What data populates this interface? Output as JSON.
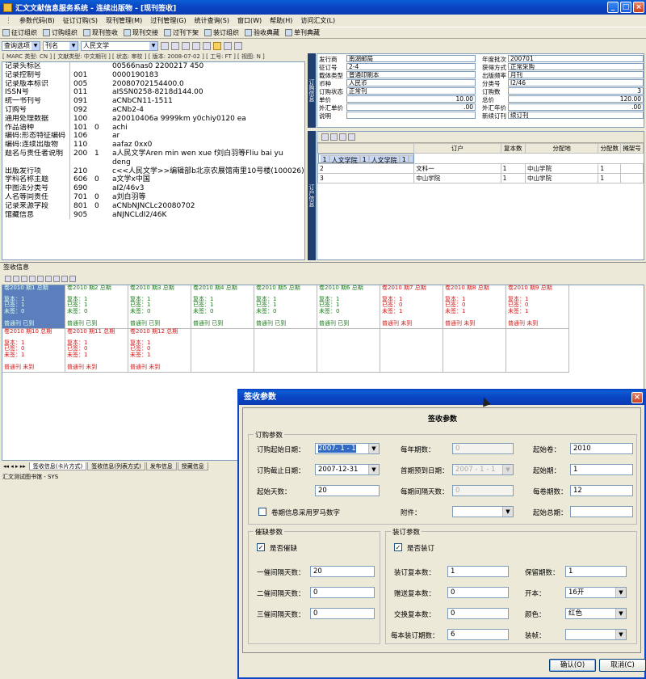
{
  "window": {
    "title": "汇文文献信息服务系统 - 连续出版物 - [现刊签收]"
  },
  "menu": [
    "参数代码(B)",
    "征订订购(S)",
    "现刊管理(M)",
    "过刊管理(G)",
    "统计查询(S)",
    "窗口(W)",
    "帮助(H)",
    "访问汇文(L)"
  ],
  "toolbar": [
    "征订组织",
    "订购组织",
    "现刊签收",
    "现刊交接",
    "过刊下架",
    "装订组织",
    "验收典藏",
    "单刊典藏"
  ],
  "query": {
    "label": "查询选项",
    "type": "刊名",
    "value": "人民文学"
  },
  "marc_header": "[ MARC 类型: CN ] [ 文献类型: 中文期刊 ] [ 状态: 审校 ] [ 版本: 2008-07-02 ] [ 工号: FT ] [ 视图: N ]",
  "marc": [
    {
      "label": "记录头标区",
      "tag": "",
      "ind": "",
      "value": "00566nas0 2200217 450"
    },
    {
      "label": "记录控制号",
      "tag": "001",
      "ind": "",
      "value": "0000190183"
    },
    {
      "label": "记录版本标识",
      "tag": "005",
      "ind": "",
      "value": "20080702154400.0"
    },
    {
      "label": "ISSN号",
      "tag": "011",
      "ind": "",
      "value": "aISSN0258-8218d144.00"
    },
    {
      "label": "统一书刊号",
      "tag": "091",
      "ind": "",
      "value": "aCNbCN11-1511"
    },
    {
      "label": "订购号",
      "tag": "092",
      "ind": "",
      "value": "aCNb2-4"
    },
    {
      "label": "通用处理数据",
      "tag": "100",
      "ind": "",
      "value": "a20010406a 9999km y0chiy0120 ea"
    },
    {
      "label": "作品语种",
      "tag": "101",
      "ind": "0",
      "value": "achi"
    },
    {
      "label": "编码:形态特征编码",
      "tag": "106",
      "ind": "",
      "value": "ar"
    },
    {
      "label": "编码:连续出版物",
      "tag": "110",
      "ind": "",
      "value": "aafaz 0xx0"
    },
    {
      "label": "题名与责任者说明",
      "tag": "200",
      "ind": "1",
      "value": "a人民文学Aren min wen xue f刘白羽等Fliu bai yu"
    },
    {
      "label": "",
      "tag": "",
      "ind": "",
      "value": "deng"
    },
    {
      "label": "出版发行项",
      "tag": "210",
      "ind": "",
      "value": "c<<人民文学>>编辑部b北京农展馆南里10号楼(100026)"
    },
    {
      "label": "学科名称主题",
      "tag": "606",
      "ind": "0",
      "value": "a文学x中国"
    },
    {
      "label": "中图法分类号",
      "tag": "690",
      "ind": "",
      "value": "aI2/46v3"
    },
    {
      "label": "人名等同责任",
      "tag": "701",
      "ind": "0",
      "value": "a刘白羽等"
    },
    {
      "label": "记录来源字段",
      "tag": "801",
      "ind": "0",
      "value": "aCNbNJNCLc20080702"
    },
    {
      "label": "馆藏信息",
      "tag": "905",
      "ind": "",
      "value": "aNJNCLdI2/46K"
    }
  ],
  "order_label": "订购信息",
  "acq_label": "订户信息",
  "order": {
    "issuer_l": "发行商",
    "issuer": "南湖邮局",
    "year_l": "年度批次",
    "year": "200701",
    "order_no_l": "征订号",
    "order_no": "2-4",
    "method_l": "获得方式",
    "method": "正常采购",
    "carrier_l": "载体类型",
    "carrier": "普通印刷本",
    "freq_l": "出版频率",
    "freq": "月刊",
    "currency_l": "币种",
    "currency": "人民币",
    "class_l": "分类号",
    "class": "I2/46",
    "status_l": "订购状态",
    "status": "正常刊",
    "copies_l": "订购数",
    "copies": "3",
    "unit_l": "单价",
    "unit": "10.00",
    "total_l": "总价",
    "total": "120.00",
    "fx_unit_l": "外汇单价",
    "fx_unit": ".00",
    "fx_year_l": "外汇年价",
    "fx_year": ".00",
    "note_l": "说明",
    "note": "",
    "new_l": "新续订刊",
    "new": "续订刊"
  },
  "subscribers": {
    "headers": [
      "",
      "订户",
      "复本数",
      "分配地",
      "分配数",
      "摊架号"
    ],
    "rows": [
      [
        "1",
        "人文学院",
        "1",
        "人文学院",
        "1",
        ""
      ],
      [
        "2",
        "文科一",
        "1",
        "中山学院",
        "1",
        ""
      ],
      [
        "3",
        "中山学院",
        "1",
        "中山学院",
        "1",
        ""
      ]
    ]
  },
  "sign_title": "签收信息",
  "cards": [
    {
      "head": "卷2010 期1 总期",
      "c1": "复本：1",
      "c2": "已签：1",
      "c3": "未签：0",
      "status": "普通刊 已到",
      "color": "green"
    },
    {
      "head": "卷2010 期2 总期",
      "c1": "复本：1",
      "c2": "已签：1",
      "c3": "未签：0",
      "status": "普通刊 已到",
      "color": "green"
    },
    {
      "head": "卷2010 期3 总期",
      "c1": "复本：1",
      "c2": "已签：1",
      "c3": "未签：0",
      "status": "普通刊 已到",
      "color": "green"
    },
    {
      "head": "卷2010 期4 总期",
      "c1": "复本：1",
      "c2": "已签：1",
      "c3": "未签：0",
      "status": "普通刊 已到",
      "color": "green"
    },
    {
      "head": "卷2010 期5 总期",
      "c1": "复本：1",
      "c2": "已签：1",
      "c3": "未签：0",
      "status": "普通刊 已到",
      "color": "green"
    },
    {
      "head": "卷2010 期6 总期",
      "c1": "复本：1",
      "c2": "已签：1",
      "c3": "未签：0",
      "status": "普通刊 已到",
      "color": "green"
    },
    {
      "head": "卷2010 期7 总期",
      "c1": "复本：1",
      "c2": "已签：0",
      "c3": "未签：1",
      "status": "普通刊 未到",
      "color": "red"
    },
    {
      "head": "卷2010 期8 总期",
      "c1": "复本：1",
      "c2": "已签：0",
      "c3": "未签：1",
      "status": "普通刊 未到",
      "color": "red"
    },
    {
      "head": "卷2010 期9 总期",
      "c1": "复本：1",
      "c2": "已签：0",
      "c3": "未签：1",
      "status": "普通刊 未到",
      "color": "red"
    },
    {
      "head": "卷2010 期10 总期",
      "c1": "复本：1",
      "c2": "已签：0",
      "c3": "未签：1",
      "status": "普通刊 未到",
      "color": "red"
    },
    {
      "head": "卷2010 期11 总期",
      "c1": "复本：1",
      "c2": "已签：0",
      "c3": "未签：1",
      "status": "普通刊 未到",
      "color": "red"
    },
    {
      "head": "卷2010 期12 总期",
      "c1": "复本：1",
      "c2": "已签：0",
      "c3": "未签：1",
      "status": "普通刊 未到",
      "color": "red"
    }
  ],
  "tabs": [
    "签收信息(卡片方式)",
    "签收信息(列表方式)",
    "发布信息",
    "授藏信息"
  ],
  "status": "汇文测试图书馆 - SYS",
  "dialog": {
    "title": "签收参数",
    "heading": "签收参数",
    "g1": "订购参数",
    "start_date_l": "订购起始日期：",
    "start_date": "2007- 1 - 1",
    "end_date_l": "订购截止日期：",
    "end_date": "2007-12-31",
    "start_days_l": "起始天数：",
    "start_days": "20",
    "roman_l": "卷期信息采用罗马数字",
    "issues_year_l": "每年期数：",
    "issues_year": "0",
    "first_date_l": "首期预到日期：",
    "first_date": "2007 - 1 - 1",
    "interval_l": "每期间隔天数：",
    "interval": "0",
    "attach_l": "附件：",
    "attach": "",
    "start_vol_l": "起始卷：",
    "start_vol": "2010",
    "start_issue_l": "起始期：",
    "start_issue": "1",
    "per_vol_l": "每卷期数：",
    "per_vol": "12",
    "start_total_l": "起始总期：",
    "start_total": "",
    "g2": "催缺参数",
    "claim_l": "是否催缺",
    "claim1_l": "一催间隔天数：",
    "claim1": "20",
    "claim2_l": "二催间隔天数：",
    "claim2": "0",
    "claim3_l": "三催间隔天数：",
    "claim3": "0",
    "g3": "装订参数",
    "bind_l": "是否装订",
    "bind_copies_l": "装订复本数：",
    "bind_copies": "1",
    "gift_copies_l": "赠送复本数：",
    "gift_copies": "0",
    "exch_copies_l": "交换复本数：",
    "exch_copies": "0",
    "issues_per_l": "每本装订期数：",
    "issues_per": "6",
    "keep_l": "保留期数：",
    "keep": "1",
    "format_l": "开本：",
    "format": "16开",
    "color_l": "颜色：",
    "color": "红色",
    "frame_l": "装帧：",
    "frame": "",
    "ok": "确认(O)",
    "cancel": "取消(C)"
  }
}
